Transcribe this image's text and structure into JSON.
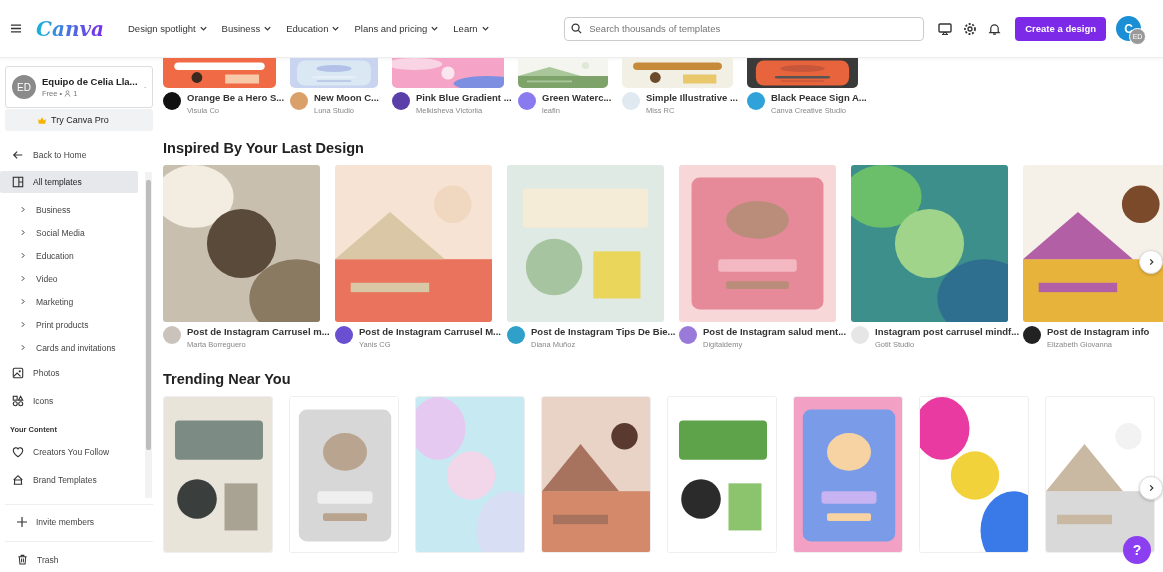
{
  "header": {
    "logo": "Canva",
    "nav": [
      {
        "label": "Design spotlight",
        "expanded": false
      },
      {
        "label": "Business",
        "expanded": false
      },
      {
        "label": "Education",
        "expanded": false
      },
      {
        "label": "Plans and pricing",
        "expanded": false
      },
      {
        "label": "Learn",
        "expanded": false
      }
    ],
    "search": {
      "placeholder": "Search thousands of templates"
    },
    "create_button": "Create a design",
    "avatar": {
      "initial": "C",
      "badge": "ED"
    }
  },
  "sidebar": {
    "team": {
      "initials": "ED",
      "name": "Equipo de Celia Lla...",
      "plan": "Free •",
      "members": "1"
    },
    "pro_button": "Try Canva Pro",
    "items": [
      {
        "kind": "back",
        "label": "Back to Home",
        "selected": false
      },
      {
        "kind": "layout",
        "label": "All templates",
        "selected": true
      },
      {
        "kind": "category",
        "label": "Business",
        "selected": false,
        "expanded": false
      },
      {
        "kind": "category",
        "label": "Social Media",
        "selected": false,
        "expanded": false
      },
      {
        "kind": "category",
        "label": "Education",
        "selected": false,
        "expanded": false
      },
      {
        "kind": "category",
        "label": "Video",
        "selected": false,
        "expanded": false
      },
      {
        "kind": "category",
        "label": "Marketing",
        "selected": false,
        "expanded": false
      },
      {
        "kind": "category",
        "label": "Print products",
        "selected": false,
        "expanded": false
      },
      {
        "kind": "category",
        "label": "Cards and invitations",
        "selected": false,
        "expanded": false
      },
      {
        "kind": "photos",
        "label": "Photos",
        "selected": false
      },
      {
        "kind": "icons",
        "label": "Icons",
        "selected": false
      },
      {
        "kind": "heading",
        "label": "Your Content"
      },
      {
        "kind": "creators",
        "label": "Creators You Follow",
        "selected": false
      },
      {
        "kind": "brand",
        "label": "Brand Templates",
        "selected": false
      }
    ],
    "invite": "Invite members",
    "trash": "Trash"
  },
  "top_row": [
    {
      "title": "Orange Be a Hero S...",
      "author": "Visula Co"
    },
    {
      "title": "New Moon C...",
      "author": "Luna Studio"
    },
    {
      "title": "Pink Blue Gradient ...",
      "author": "Melkisheva Victoriia"
    },
    {
      "title": "Green Waterc...",
      "author": "leafin"
    },
    {
      "title": "Simple Illustrative ...",
      "author": "Miss RC"
    },
    {
      "title": "Black Peace Sign A...",
      "author": "Canva Creative Studio"
    }
  ],
  "sections": [
    {
      "title": "Inspired By Your Last Design",
      "cards": [
        {
          "title": "Post de Instagram Carrusel m...",
          "author": "Marta Borreguero"
        },
        {
          "title": "Post de Instagram Carrusel M...",
          "author": "Yanis CG"
        },
        {
          "title": "Post de Instagram Tips De Bie...",
          "author": "Diana Muñoz"
        },
        {
          "title": "Post de Instagram salud ment...",
          "author": "Digitaldemy"
        },
        {
          "title": "Instagram post carrusel mindf...",
          "author": "Gotit Studio"
        },
        {
          "title": "Post de Instagram info",
          "author": "Elizabeth Giovanna"
        }
      ]
    },
    {
      "title": "Trending Near You"
    }
  ],
  "help_button": "?"
}
